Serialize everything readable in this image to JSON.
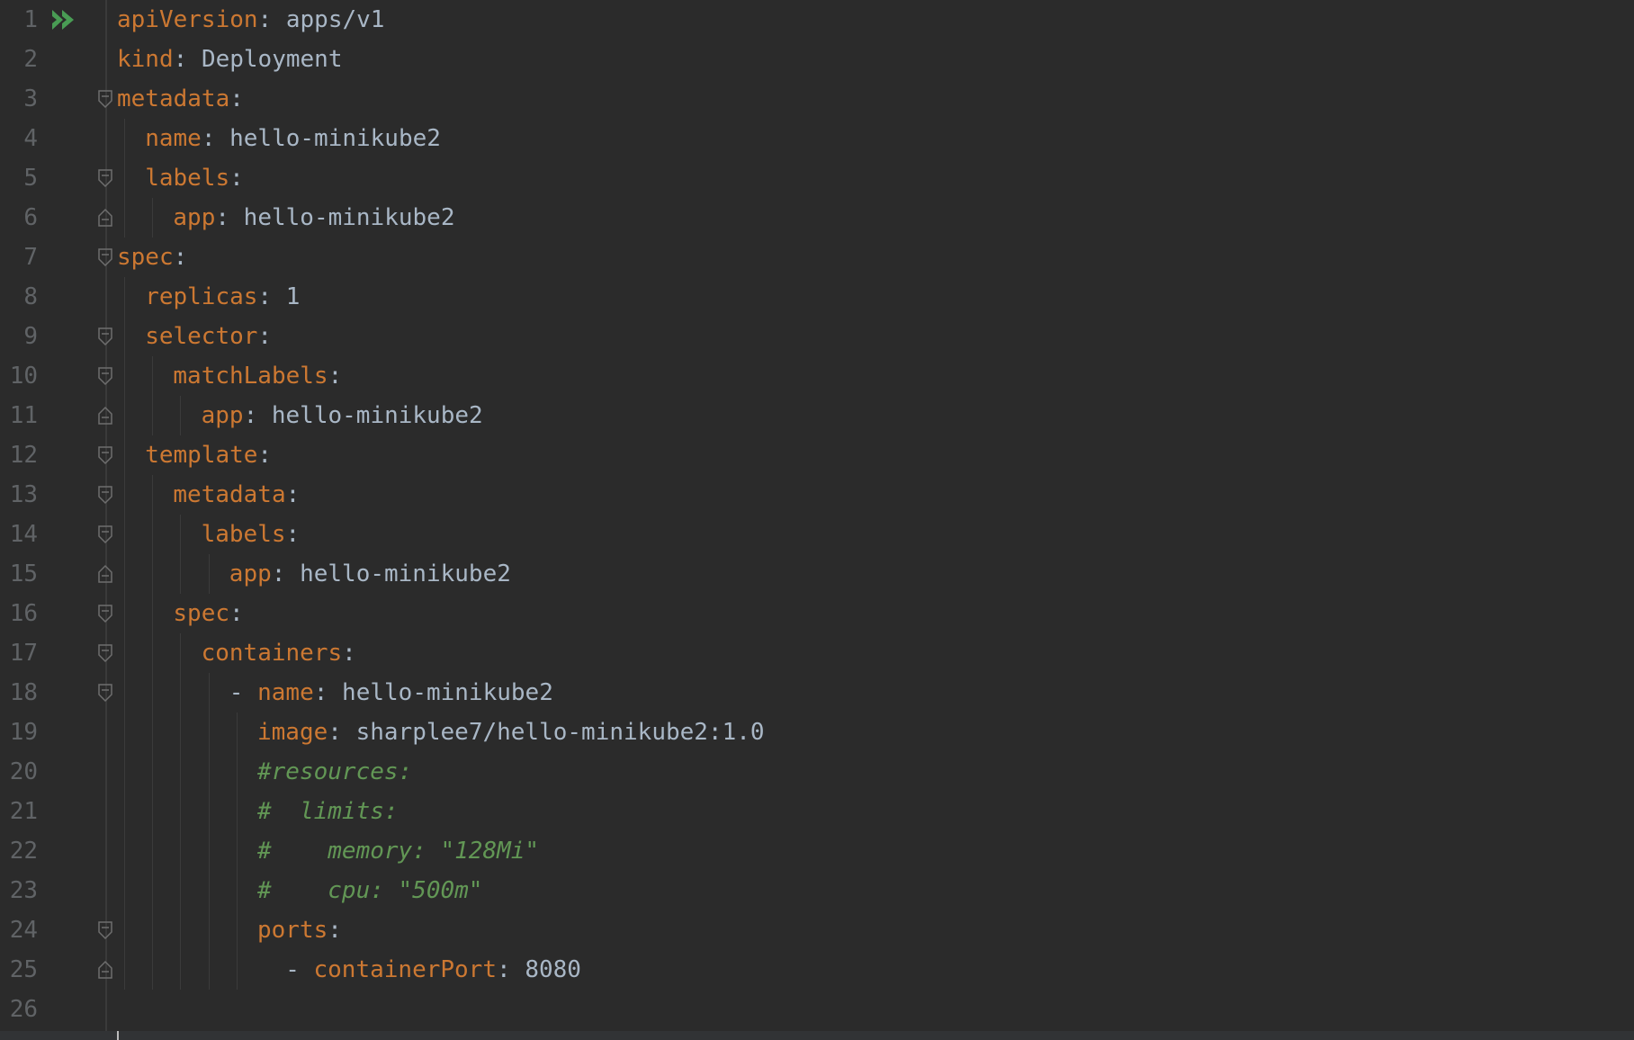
{
  "editor": {
    "language": "yaml",
    "lines": [
      {
        "num": "1",
        "indent": 0,
        "key": "apiVersion",
        "sep": ": ",
        "value": "apps/v1",
        "run": true
      },
      {
        "num": "2",
        "indent": 0,
        "key": "kind",
        "sep": ": ",
        "value": "Deployment"
      },
      {
        "num": "3",
        "indent": 0,
        "key": "metadata",
        "sep": ":",
        "value": "",
        "fold": "open"
      },
      {
        "num": "4",
        "indent": 1,
        "key": "name",
        "sep": ": ",
        "value": "hello-minikube2"
      },
      {
        "num": "5",
        "indent": 1,
        "key": "labels",
        "sep": ":",
        "value": "",
        "fold": "open"
      },
      {
        "num": "6",
        "indent": 2,
        "key": "app",
        "sep": ": ",
        "value": "hello-minikube2",
        "fold": "end"
      },
      {
        "num": "7",
        "indent": 0,
        "key": "spec",
        "sep": ":",
        "value": "",
        "fold": "open"
      },
      {
        "num": "8",
        "indent": 1,
        "key": "replicas",
        "sep": ": ",
        "value": "1"
      },
      {
        "num": "9",
        "indent": 1,
        "key": "selector",
        "sep": ":",
        "value": "",
        "fold": "open"
      },
      {
        "num": "10",
        "indent": 2,
        "key": "matchLabels",
        "sep": ":",
        "value": "",
        "fold": "open"
      },
      {
        "num": "11",
        "indent": 3,
        "key": "app",
        "sep": ": ",
        "value": "hello-minikube2",
        "fold": "end"
      },
      {
        "num": "12",
        "indent": 1,
        "key": "template",
        "sep": ":",
        "value": "",
        "fold": "open"
      },
      {
        "num": "13",
        "indent": 2,
        "key": "metadata",
        "sep": ":",
        "value": "",
        "fold": "open"
      },
      {
        "num": "14",
        "indent": 3,
        "key": "labels",
        "sep": ":",
        "value": "",
        "fold": "open"
      },
      {
        "num": "15",
        "indent": 4,
        "key": "app",
        "sep": ": ",
        "value": "hello-minikube2",
        "fold": "end"
      },
      {
        "num": "16",
        "indent": 2,
        "key": "spec",
        "sep": ":",
        "value": "",
        "fold": "open"
      },
      {
        "num": "17",
        "indent": 3,
        "key": "containers",
        "sep": ":",
        "value": "",
        "fold": "open"
      },
      {
        "num": "18",
        "indent": 4,
        "dash": "- ",
        "key": "name",
        "sep": ": ",
        "value": "hello-minikube2",
        "fold": "open"
      },
      {
        "num": "19",
        "indent": 5,
        "key": "image",
        "sep": ": ",
        "value": "sharplee7/hello-minikube2:1.0"
      },
      {
        "num": "20",
        "indent": 5,
        "comment": "#resources:"
      },
      {
        "num": "21",
        "indent": 5,
        "comment": "#  limits:"
      },
      {
        "num": "22",
        "indent": 5,
        "comment": "#    memory: \"128Mi\""
      },
      {
        "num": "23",
        "indent": 5,
        "comment": "#    cpu: \"500m\""
      },
      {
        "num": "24",
        "indent": 5,
        "key": "ports",
        "sep": ":",
        "value": "",
        "fold": "open"
      },
      {
        "num": "25",
        "indent": 6,
        "dash": "- ",
        "key": "containerPort",
        "sep": ": ",
        "value": "8080",
        "fold": "end"
      },
      {
        "num": "26",
        "indent": 0,
        "key": "",
        "sep": "",
        "value": ""
      }
    ]
  },
  "colors": {
    "background": "#2b2b2b",
    "key": "#cc7832",
    "value": "#a9b7c6",
    "comment": "#629755",
    "line_number": "#606366",
    "run_icon": "#499c54"
  },
  "icons": {
    "run": "run-all-icon",
    "fold_open": "fold-collapse-icon",
    "fold_end": "fold-end-icon"
  }
}
